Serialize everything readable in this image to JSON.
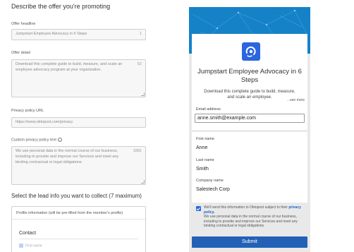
{
  "form": {
    "section_title": "Describe the offer you're promoting",
    "headline": {
      "label": "Offer headline",
      "value": "Jumpstart Employee Advocacy in 6 Steps",
      "counter": "1"
    },
    "detail": {
      "label": "Offer detail",
      "value": "Download this complete guide to build, measure, and scale an employee advocacy program at your organization.",
      "counter": "52"
    },
    "privacy_url": {
      "label": "Privacy policy URL",
      "value": "https://www.oktopost.com/privacy"
    },
    "privacy_text": {
      "label": "Custom privacy policy text",
      "info_icon": "info-icon",
      "value": "We use personal data in the normal course of our business, including to provide and improve our Services and meet any binding contractual or legal obligations.",
      "counter": "1881"
    },
    "lead_section_title": "Select the lead info you want to collect (7 maximum)",
    "lead_box_header": "Profile information (will be pre-filled from the member's profile)",
    "contact_title": "Contact",
    "first_row": "First name"
  },
  "preview": {
    "logo_icon": "oktopost-logo-icon",
    "title": "Jumpstart Employee Advocacy in 6 Steps",
    "desc": "Download this complete guide to build, measure, and scale an employee.",
    "see_more": "see more",
    "email_label": "Email address",
    "email_value": "anne.smith@example.com",
    "first_name_label": "First name",
    "first_name_value": "Anne",
    "last_name_label": "Last name",
    "last_name_value": "Smith",
    "company_label": "Company name",
    "company_value": "Salestech Corp",
    "consent_prefix": "We'll send this information to Oktopost subject to their",
    "consent_link": "privacy policy.",
    "consent_body": "We use personal data in the normal course of our business, including to provide and improve our Services and meet any binding contractual or legal obligations.",
    "submit_label": "Submit"
  },
  "colors": {
    "accent": "#2361b6",
    "banner": "#1582c8",
    "logo": "#2a66df"
  }
}
